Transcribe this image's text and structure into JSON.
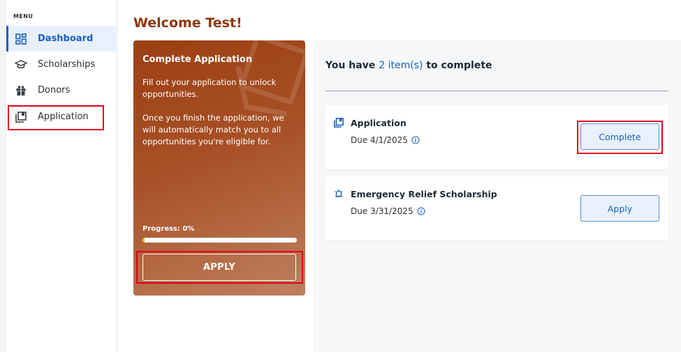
{
  "sidebar": {
    "menu_label": "MENU",
    "items": [
      {
        "label": "Dashboard",
        "icon": "dashboard-icon",
        "active": true
      },
      {
        "label": "Scholarships",
        "icon": "graduation-cap-icon",
        "active": false
      },
      {
        "label": "Donors",
        "icon": "gift-icon",
        "active": false
      },
      {
        "label": "Application",
        "icon": "application-icon",
        "active": false
      }
    ]
  },
  "main": {
    "welcome": "Welcome Test!",
    "promo": {
      "title": "Complete Application",
      "paragraph1": "Fill out your application to unlock opportunities.",
      "paragraph2": "Once you finish the application, we will automatically match you to all opportunities you're eligible for.",
      "progress_label": "Progress: 0%",
      "progress_value": 0,
      "button_label": "APPLY"
    },
    "todo": {
      "prefix": "You have ",
      "count_text": "2 item(s)",
      "suffix": " to complete",
      "items": [
        {
          "title": "Application",
          "due": "Due 4/1/2025",
          "icon": "application-icon",
          "button": "Complete"
        },
        {
          "title": "Emergency Relief Scholarship",
          "due": "Due 3/31/2025",
          "icon": "alarm-icon",
          "button": "Apply"
        }
      ]
    }
  },
  "colors": {
    "accent": "#1a5fc0",
    "brand": "#8f360c",
    "highlight": "#e3001b"
  }
}
